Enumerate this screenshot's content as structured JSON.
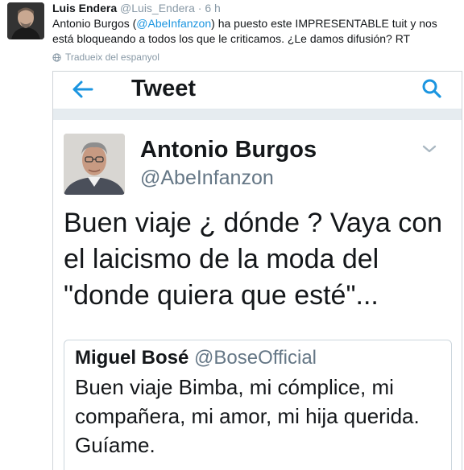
{
  "outer_tweet": {
    "name": "Luis Endera",
    "handle": "@Luis_Endera",
    "dot": "·",
    "time": "6 h",
    "text_before": "Antonio Burgos (",
    "mention": "@AbeInfanzon",
    "text_after": ") ha puesto este IMPRESENTABLE tuit y nos está bloqueando a todos los que le criticamos. ¿Le damos difusión? RT",
    "translate": "Tradueix del espanyol"
  },
  "screenshot": {
    "topbar_title": "Tweet",
    "author": {
      "name": "Antonio Burgos",
      "handle": "@AbeInfanzon"
    },
    "text": "Buen viaje ¿ dónde ? Vaya con el laicismo de la moda del \"donde quiera que esté\"...",
    "quote": {
      "name": "Miguel Bosé",
      "handle": "@BoseOfficial",
      "text": "Buen viaje Bimba, mi cómplice, mi compañera, mi amor, mi hija querida. Guíame."
    }
  },
  "colors": {
    "accent": "#1b95e0",
    "muted": "#8899a6",
    "text": "#14171a"
  },
  "icons": [
    "globe-icon",
    "back-arrow-icon",
    "search-icon",
    "chevron-down-icon"
  ]
}
